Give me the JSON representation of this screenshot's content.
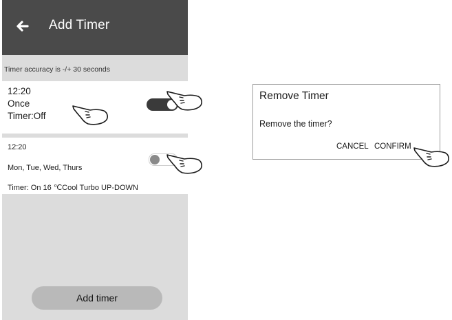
{
  "header": {
    "title": "Add Timer",
    "back_icon": "back-arrow-icon"
  },
  "notice": "Timer accuracy is -/+ 30 seconds",
  "timers": [
    {
      "time": "12:20",
      "repeat": "Once",
      "status": "Timer:Off",
      "enabled": true
    },
    {
      "time": "12:20",
      "repeat": "Mon, Tue, Wed, Thurs",
      "settings": "Timer: On 16  ℃Cool  Turbo  UP-DOWN",
      "enabled": false
    }
  ],
  "add_button": {
    "label": "Add timer"
  },
  "dialog": {
    "title": "Remove Timer",
    "message": "Remove the timer?",
    "cancel": "CANCEL",
    "confirm": "CONFIRM"
  },
  "icons": {
    "pointer": "pointing-hand-icon"
  },
  "colors": {
    "header_bg": "#4a4a4a",
    "screen_bg": "#dcdcdc",
    "button_bg": "#b9b9b9",
    "toggle_on": "#3a3a3a"
  }
}
